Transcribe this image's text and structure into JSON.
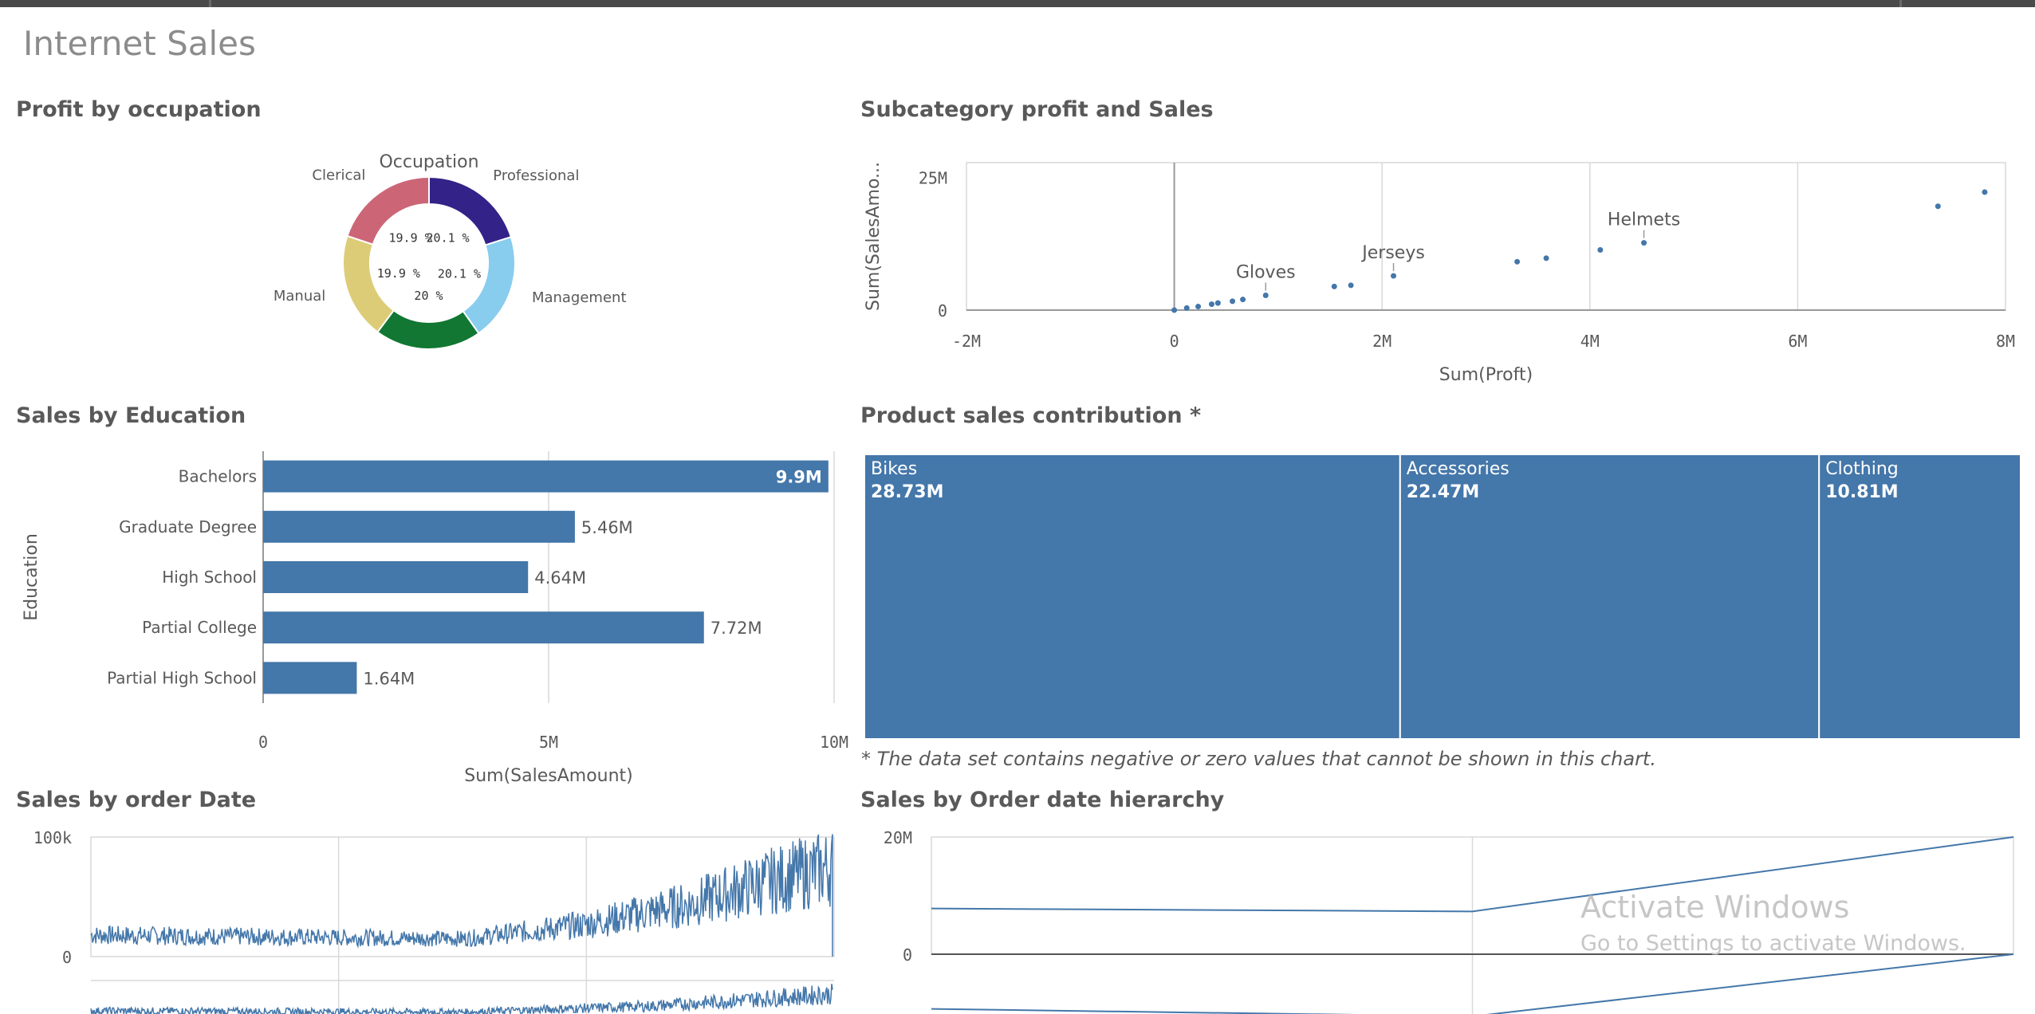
{
  "page": {
    "title": "Internet Sales"
  },
  "panels": {
    "occupation": "Profit by occupation",
    "subcategory": "Subcategory profit and Sales",
    "education": "Sales by Education",
    "contribution": "Product sales contribution *",
    "order_date": "Sales by order Date",
    "order_hierarchy": "Sales by Order date hierarchy"
  },
  "contribution_note": "* The data set contains negative or zero values that cannot be shown in this chart.",
  "watermark": {
    "line1": "Activate Windows",
    "line2": "Go to Settings to activate Windows."
  },
  "colors": {
    "bar": "#4477aa",
    "grid": "#d9d9d9",
    "axis": "#595959",
    "text": "#595959"
  },
  "chart_data": [
    {
      "id": "occupation",
      "type": "pie",
      "title": "Occupation",
      "donut": true,
      "slices": [
        {
          "label": "Professional",
          "pct_label": "20.1 %",
          "value": 20.1,
          "color": "#332288"
        },
        {
          "label": "Management",
          "pct_label": "20.1 %",
          "value": 20.1,
          "color": "#88ccee"
        },
        {
          "label": "",
          "pct_label": "20 %",
          "value": 20.0,
          "color": "#117733"
        },
        {
          "label": "Manual",
          "pct_label": "19.9 %",
          "value": 19.9,
          "color": "#ddcc77"
        },
        {
          "label": "Clerical",
          "pct_label": "19.9 %",
          "value": 19.9,
          "color": "#cc6677"
        }
      ]
    },
    {
      "id": "subcategory",
      "type": "scatter",
      "xlabel": "Sum(Proft)",
      "ylabel": "Sum(SalesAmo...",
      "xlim": [
        -2000000,
        8000000
      ],
      "ylim": [
        0,
        25000000
      ],
      "xticks": [
        {
          "v": -2000000,
          "label": "-2M"
        },
        {
          "v": 0,
          "label": "0"
        },
        {
          "v": 2000000,
          "label": "2M"
        },
        {
          "v": 4000000,
          "label": "4M"
        },
        {
          "v": 6000000,
          "label": "6M"
        },
        {
          "v": 8000000,
          "label": "8M"
        }
      ],
      "yticks": [
        {
          "v": 0,
          "label": "0"
        },
        {
          "v": 22500000,
          "label": "25M"
        }
      ],
      "points": [
        {
          "x": 0,
          "y": 0,
          "label": ""
        },
        {
          "x": 120000,
          "y": 350000,
          "label": ""
        },
        {
          "x": 230000,
          "y": 600000,
          "label": ""
        },
        {
          "x": 360000,
          "y": 1000000,
          "label": ""
        },
        {
          "x": 420000,
          "y": 1200000,
          "label": ""
        },
        {
          "x": 560000,
          "y": 1500000,
          "label": ""
        },
        {
          "x": 660000,
          "y": 1800000,
          "label": ""
        },
        {
          "x": 880000,
          "y": 2500000,
          "label": "Gloves"
        },
        {
          "x": 1540000,
          "y": 4000000,
          "label": ""
        },
        {
          "x": 1700000,
          "y": 4200000,
          "label": ""
        },
        {
          "x": 2110000,
          "y": 5800000,
          "label": "Jerseys"
        },
        {
          "x": 3300000,
          "y": 8200000,
          "label": ""
        },
        {
          "x": 3580000,
          "y": 8800000,
          "label": ""
        },
        {
          "x": 4100000,
          "y": 10200000,
          "label": ""
        },
        {
          "x": 4520000,
          "y": 11400000,
          "label": "Helmets"
        },
        {
          "x": 7350000,
          "y": 17600000,
          "label": ""
        },
        {
          "x": 7800000,
          "y": 20000000,
          "label": ""
        }
      ]
    },
    {
      "id": "education",
      "type": "bar",
      "orientation": "horizontal",
      "xlabel": "Sum(SalesAmount)",
      "ylabel": "Education",
      "xlim": [
        0,
        10000000
      ],
      "xticks": [
        {
          "v": 0,
          "label": "0"
        },
        {
          "v": 5000000,
          "label": "5M"
        },
        {
          "v": 10000000,
          "label": "10M"
        }
      ],
      "categories": [
        "Bachelors",
        "Graduate Degree",
        "High School",
        "Partial College",
        "Partial High School"
      ],
      "values": [
        9900000,
        5460000,
        4640000,
        7720000,
        1640000
      ],
      "value_labels": [
        "9.9M",
        "5.46M",
        "4.64M",
        "7.72M",
        "1.64M"
      ]
    },
    {
      "id": "contribution",
      "type": "treemap",
      "items": [
        {
          "name": "Bikes",
          "value": 28.73,
          "label": "28.73M"
        },
        {
          "name": "Accessories",
          "value": 22.47,
          "label": "22.47M"
        },
        {
          "name": "Clothing",
          "value": 10.81,
          "label": "10.81M"
        }
      ]
    },
    {
      "id": "order_date",
      "type": "line",
      "ylim": [
        0,
        100000
      ],
      "yticks": [
        {
          "v": 0,
          "label": "0"
        },
        {
          "v": 100000,
          "label": "100k"
        }
      ],
      "series": [
        {
          "name": "",
          "segments": [
            {
              "t": 0.0,
              "v": 18000
            },
            {
              "t": 0.33,
              "v": 16000
            },
            {
              "t": 0.5,
              "v": 15000
            },
            {
              "t": 0.66,
              "v": 27000
            },
            {
              "t": 0.8,
              "v": 44000
            },
            {
              "t": 0.9,
              "v": 62000
            },
            {
              "t": 0.99,
              "v": 75000
            }
          ]
        },
        {
          "name": "",
          "segments": [
            {
              "t": 0.0,
              "v": 8000
            },
            {
              "t": 0.5,
              "v": 7000
            },
            {
              "t": 0.75,
              "v": 12000
            },
            {
              "t": 0.99,
              "v": 22000
            }
          ]
        }
      ]
    },
    {
      "id": "order_hierarchy",
      "type": "line",
      "ylim": [
        -10000000,
        20000000
      ],
      "yticks": [
        {
          "v": 0,
          "label": "0"
        },
        {
          "v": 20000000,
          "label": "20M"
        }
      ],
      "series": [
        {
          "name": "",
          "x": [
            0,
            1,
            2
          ],
          "values": [
            7800000,
            7300000,
            20000000
          ]
        },
        {
          "name": "",
          "x": [
            0,
            1,
            2
          ],
          "values": [
            -8800000,
            -10000000,
            0
          ]
        }
      ]
    }
  ]
}
